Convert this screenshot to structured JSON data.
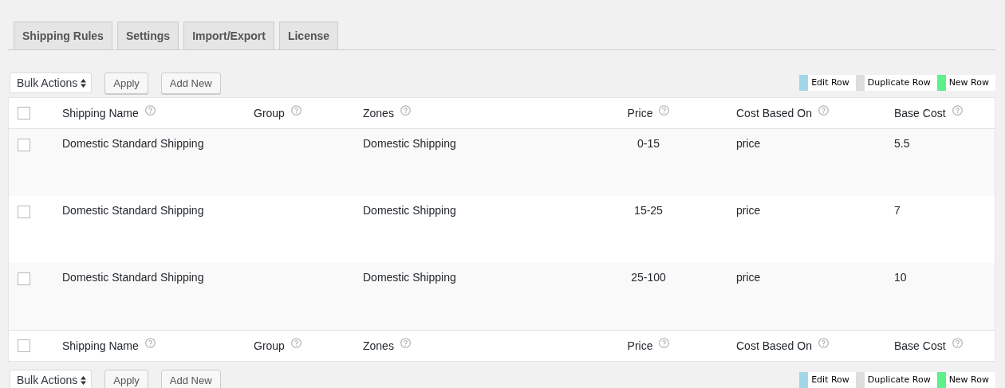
{
  "tabs": [
    {
      "label": "Shipping Rules"
    },
    {
      "label": "Settings"
    },
    {
      "label": "Import/Export"
    },
    {
      "label": "License"
    }
  ],
  "toolbar": {
    "bulk_actions": "Bulk Actions",
    "apply": "Apply",
    "add_new": "Add New"
  },
  "legend": [
    {
      "label": "Edit Row",
      "color": "#a3d7e8"
    },
    {
      "label": "Duplicate Row",
      "color": "#dddddd"
    },
    {
      "label": "New Row",
      "color": "#5df08b"
    }
  ],
  "select_all": {
    "checked": false
  },
  "columns": [
    "Shipping Name",
    "Group",
    "Zones",
    "Price",
    "Cost Based On",
    "Base Cost"
  ],
  "rows": [
    {
      "checked": false,
      "cells": [
        "Domestic Standard Shipping",
        "",
        "Domestic Shipping",
        "0-15",
        "price",
        "5.5"
      ]
    },
    {
      "checked": false,
      "cells": [
        "Domestic Standard Shipping",
        "",
        "Domestic Shipping",
        "15-25",
        "price",
        "7"
      ]
    },
    {
      "checked": false,
      "cells": [
        "Domestic Standard Shipping",
        "",
        "Domestic Shipping",
        "25-100",
        "price",
        "10"
      ]
    }
  ],
  "footer_select_all": {
    "checked": false
  },
  "footer_columns": [
    "Shipping Name",
    "Group",
    "Zones",
    "Price",
    "Cost Based On",
    "Base Cost"
  ],
  "bottom_toolbar": {
    "bulk_actions": "Bulk Actions",
    "apply": "Apply",
    "add_new": "Add New"
  },
  "bottom_legend": [
    {
      "label": "Edit Row",
      "color": "#a3d7e8"
    },
    {
      "label": "Duplicate Row",
      "color": "#dddddd"
    },
    {
      "label": "New Row",
      "color": "#5df08b"
    }
  ]
}
